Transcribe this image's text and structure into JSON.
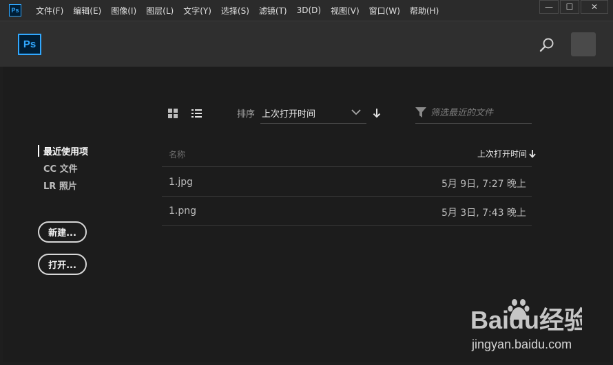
{
  "app": {
    "logo_text": "Ps"
  },
  "menu": [
    {
      "label": "文件(F)"
    },
    {
      "label": "编辑(E)"
    },
    {
      "label": "图像(I)"
    },
    {
      "label": "图层(L)"
    },
    {
      "label": "文字(Y)"
    },
    {
      "label": "选择(S)"
    },
    {
      "label": "滤镜(T)"
    },
    {
      "label": "3D(D)"
    },
    {
      "label": "视图(V)"
    },
    {
      "label": "窗口(W)"
    },
    {
      "label": "帮助(H)"
    }
  ],
  "window_controls": {
    "minimize": "—",
    "maximize": "☐",
    "close": "✕"
  },
  "sidebar": {
    "items": [
      {
        "label": "最近使用项",
        "active": true
      },
      {
        "label": "CC 文件",
        "active": false
      },
      {
        "label": "LR 照片",
        "active": false
      }
    ],
    "new_button": "新建...",
    "open_button": "打开..."
  },
  "toolbar": {
    "sort_label": "排序",
    "sort_value": "上次打开时间",
    "filter_placeholder": "筛选最近的文件"
  },
  "table": {
    "col_name": "名称",
    "col_date": "上次打开时间",
    "rows": [
      {
        "name": "1.jpg",
        "date": "5月 9日, 7:27 晚上"
      },
      {
        "name": "1.png",
        "date": "5月 3日, 7:43 晚上"
      }
    ]
  },
  "watermark": {
    "brand": "Baidu经验",
    "url": "jingyan.baidu.com"
  },
  "colors": {
    "accent": "#31a8ff",
    "background": "#1c1c1c",
    "header": "#2f2f2f"
  }
}
